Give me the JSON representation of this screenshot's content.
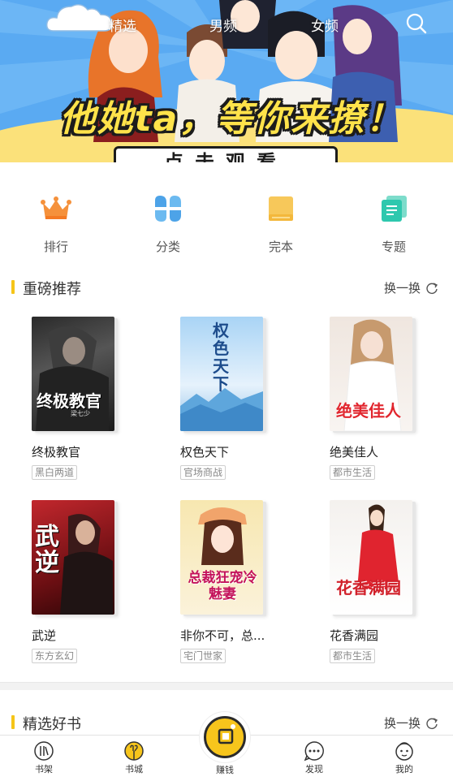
{
  "banner": {
    "slogan": "他她ta，等你来撩！",
    "cta": "点击观看",
    "colors": {
      "sky": "#58a8f0",
      "band": "#fbe17a",
      "slogan": "#ffe34a"
    }
  },
  "top_tabs": [
    {
      "label": "精选"
    },
    {
      "label": "男频"
    },
    {
      "label": "女频"
    }
  ],
  "top_icons": {
    "search": "search-icon"
  },
  "categories": [
    {
      "label": "排行",
      "icon": "crown-icon",
      "color": "#f5913b"
    },
    {
      "label": "分类",
      "icon": "grid-petal-icon",
      "color": "#4da3e8"
    },
    {
      "label": "完本",
      "icon": "book-icon",
      "color": "#f7c85a"
    },
    {
      "label": "专题",
      "icon": "stack-icon",
      "color": "#2ec8ae"
    }
  ],
  "recommend": {
    "title": "重磅推荐",
    "refresh_label": "换一换",
    "books": [
      {
        "name": "终极教官",
        "tag": "黑白两道",
        "cover_title": "终极教官",
        "cover_author": "梁七少"
      },
      {
        "name": "权色天下",
        "tag": "官场商战",
        "cover_title": "权色天下"
      },
      {
        "name": "绝美佳人",
        "tag": "都市生活",
        "cover_title": "绝美佳人"
      },
      {
        "name": "武逆",
        "tag": "东方玄幻",
        "cover_title": "武逆"
      },
      {
        "name": "非你不可，总...",
        "tag": "宅门世家",
        "cover_title": "总裁狂宠冷魅妻"
      },
      {
        "name": "花香满园",
        "tag": "都市生活",
        "cover_title": "花香满园"
      }
    ]
  },
  "featured": {
    "title": "精选好书",
    "refresh_label": "换一换"
  },
  "bottom_tabs": [
    {
      "label": "书架",
      "icon": "bookshelf-icon"
    },
    {
      "label": "书城",
      "icon": "bookstore-icon"
    },
    {
      "label": "赚钱",
      "icon": "coin-icon"
    },
    {
      "label": "发现",
      "icon": "discover-icon"
    },
    {
      "label": "我的",
      "icon": "profile-icon"
    }
  ],
  "accent": "#f5c518"
}
